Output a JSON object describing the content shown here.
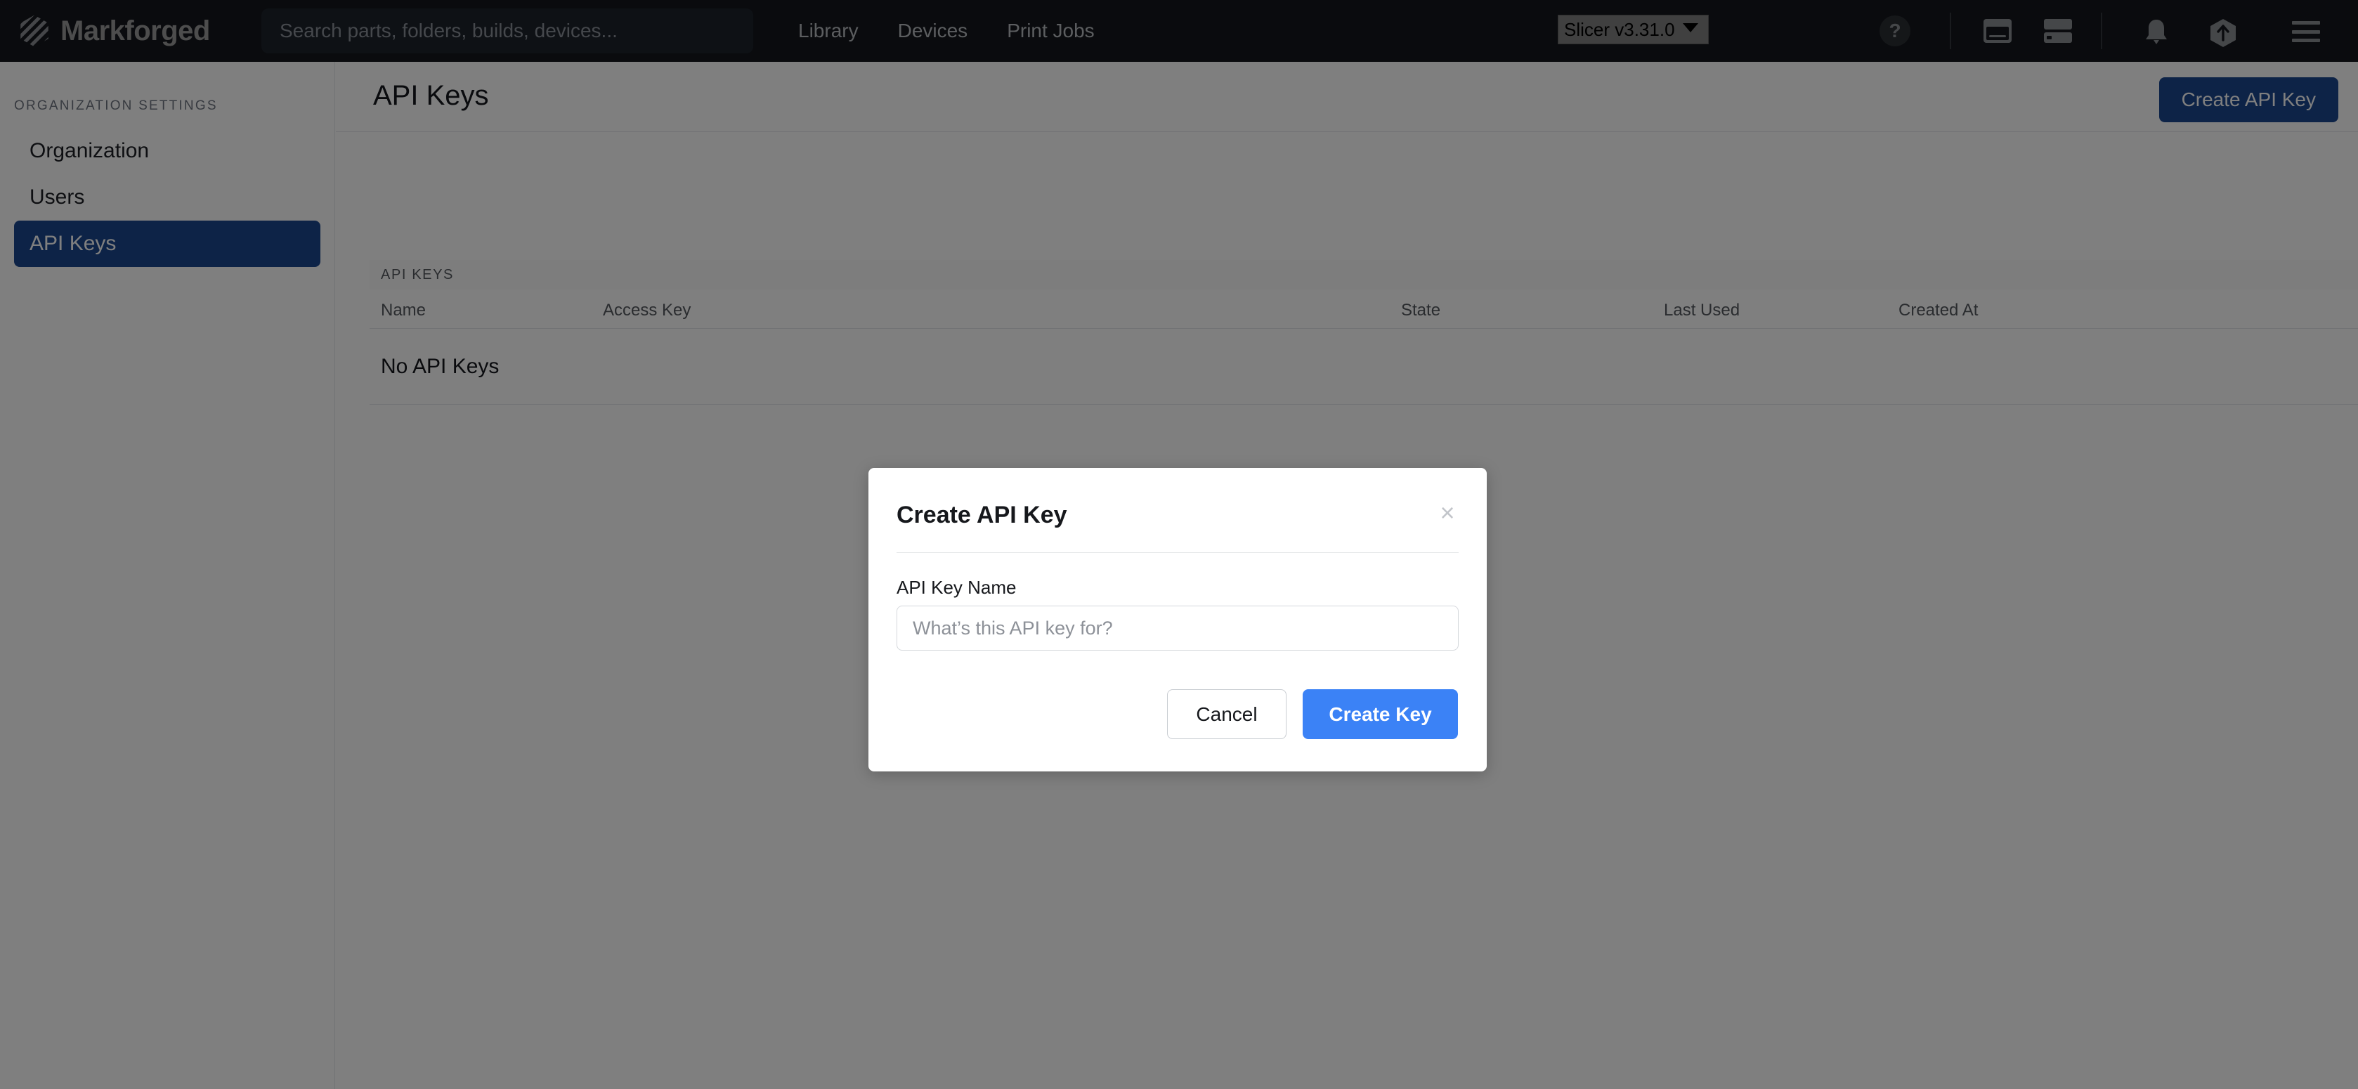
{
  "topbar": {
    "brand": "Markforged",
    "logo_icon": "markforged-hexagon-logo-icon",
    "search": {
      "placeholder": "Search parts, folders, builds, devices...",
      "value": ""
    },
    "nav": [
      {
        "label": "Library"
      },
      {
        "label": "Devices"
      },
      {
        "label": "Print Jobs"
      }
    ],
    "version_select": {
      "selected": "Slicer v3.31.0",
      "options": [
        "Slicer v3.31.0"
      ]
    },
    "help_label": "?",
    "icons": [
      {
        "name": "window-icon"
      },
      {
        "name": "server-rack-icon"
      },
      {
        "name": "bell-icon"
      },
      {
        "name": "upload-hexagon-icon"
      },
      {
        "name": "hamburger-menu-icon"
      }
    ]
  },
  "sidebar": {
    "heading": "ORGANIZATION SETTINGS",
    "items": [
      {
        "label": "Organization",
        "active": false
      },
      {
        "label": "Users",
        "active": false
      },
      {
        "label": "API Keys",
        "active": true
      }
    ]
  },
  "page": {
    "title": "API Keys",
    "create_button": "Create API Key",
    "panel_label": "API KEYS",
    "columns": [
      "Name",
      "Access Key",
      "State",
      "Last Used",
      "Created At"
    ],
    "empty_message": "No API Keys",
    "rows": []
  },
  "modal": {
    "title": "Create API Key",
    "close_glyph": "×",
    "field_label": "API Key Name",
    "field_placeholder": "What’s this API key for?",
    "field_value": "",
    "cancel_label": "Cancel",
    "submit_label": "Create Key"
  },
  "colors": {
    "topbar_bg": "#14171c",
    "sidebar_active": "#1b478f",
    "primary_button": "#1b478f",
    "modal_primary": "#3b82f6"
  }
}
